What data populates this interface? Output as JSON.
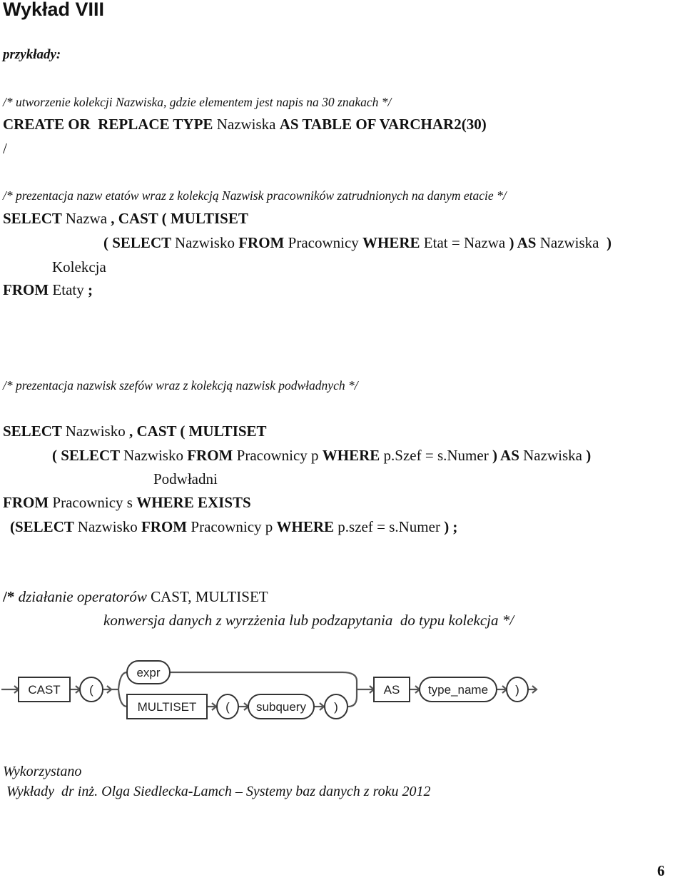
{
  "document": {
    "title": "Wykład VIII",
    "subtitle": "przykłady:",
    "page_number": "6"
  },
  "section1": {
    "comment": "/* utworzenie kolekcji Nazwiska, gdzie elementem jest napis na 30 znakach */",
    "line1": [
      {
        "t": "CREATE OR  REPLACE TYPE ",
        "b": true
      },
      {
        "t": "Nazwiska ",
        "b": false
      },
      {
        "t": "AS TABLE OF VARCHAR2(30)",
        "b": true
      }
    ],
    "line2": "/"
  },
  "section2": {
    "comment": "/* prezentacja nazw etatów wraz z kolekcją Nazwisk pracowników zatrudnionych na danym etacie */",
    "lines": [
      [
        {
          "t": "SELECT ",
          "b": true
        },
        {
          "t": "Nazwa ",
          "b": false
        },
        {
          "t": ", CAST ( MULTISET",
          "b": true
        }
      ],
      [
        {
          "t": "( SELECT ",
          "b": true
        },
        {
          "t": "Nazwisko ",
          "b": false
        },
        {
          "t": "FROM ",
          "b": true
        },
        {
          "t": "Pracownicy ",
          "b": false
        },
        {
          "t": "WHERE ",
          "b": true
        },
        {
          "t": "Etat = Nazwa ",
          "b": false
        },
        {
          "t": ") AS ",
          "b": true
        },
        {
          "t": "Nazwiska  ",
          "b": false
        },
        {
          "t": ")",
          "b": true
        }
      ],
      [
        {
          "t": "Kolekcja",
          "b": false
        }
      ],
      [
        {
          "t": "FROM ",
          "b": true
        },
        {
          "t": "Etaty ",
          "b": false
        },
        {
          "t": ";",
          "b": true
        }
      ]
    ]
  },
  "section3": {
    "comment": "/* prezentacja nazwisk szefów wraz z kolekcją nazwisk podwładnych */",
    "lines": [
      [
        {
          "t": "SELECT ",
          "b": true
        },
        {
          "t": "Nazwisko ",
          "b": false
        },
        {
          "t": ", CAST ( MULTISET",
          "b": true
        }
      ],
      [
        {
          "t": "( SELECT ",
          "b": true
        },
        {
          "t": "Nazwisko ",
          "b": false
        },
        {
          "t": "FROM ",
          "b": true
        },
        {
          "t": "Pracownicy p ",
          "b": false
        },
        {
          "t": "WHERE ",
          "b": true
        },
        {
          "t": "p.Szef = s.Numer ",
          "b": false
        },
        {
          "t": ") AS ",
          "b": true
        },
        {
          "t": "Nazwiska ",
          "b": false
        },
        {
          "t": ")",
          "b": true
        }
      ],
      [
        {
          "t": "Podwładni",
          "b": false
        }
      ],
      [
        {
          "t": "FROM ",
          "b": true
        },
        {
          "t": "Pracownicy s ",
          "b": false
        },
        {
          "t": "WHERE EXISTS",
          "b": true
        }
      ],
      [
        {
          "t": "(SELECT ",
          "b": true
        },
        {
          "t": "Nazwisko ",
          "b": false
        },
        {
          "t": "FROM ",
          "b": true
        },
        {
          "t": "Pracownicy p ",
          "b": false
        },
        {
          "t": "WHERE ",
          "b": true
        },
        {
          "t": "p.szef = s.Numer ",
          "b": false
        },
        {
          "t": ") ;",
          "b": true
        }
      ]
    ]
  },
  "section4": {
    "comment_prefix": "/*",
    "comment_line1_italic": " działanie operatorów ",
    "comment_line1_plain": "CAST, MULTISET",
    "comment_line2": "konwersja danych z wyrzżenia lub podzapytania  do typu kolekcja */"
  },
  "diagram": {
    "nodes": {
      "cast": "CAST",
      "open_paren": "(",
      "expr": "expr",
      "multiset": "MULTISET",
      "sub_open_paren": "(",
      "subquery": "subquery",
      "sub_close_paren": ")",
      "as": "AS",
      "type_name": "type_name",
      "close_paren": ")"
    }
  },
  "credits": {
    "line1": "Wykorzystano",
    "line2": " Wykłady  dr inż. Olga Siedlecka-Lamch – Systemy baz danych z roku 2012"
  }
}
